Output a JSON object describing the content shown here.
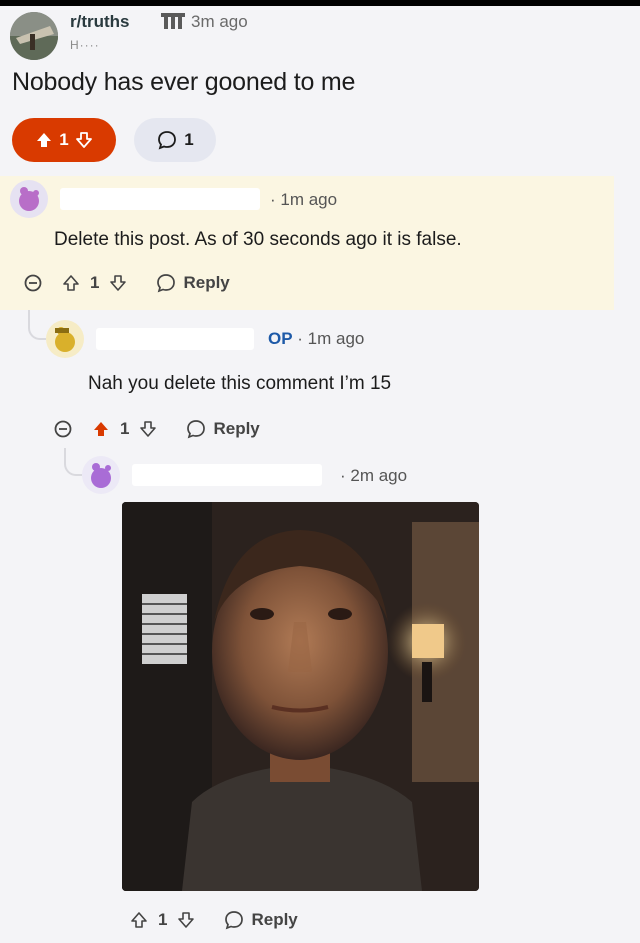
{
  "post": {
    "subreddit": "r/truths",
    "time": "3m ago",
    "flair": "H····",
    "title": "Nobody has ever gooned to me",
    "votes": "1",
    "comments": "1"
  },
  "comments": [
    {
      "meta": "· 1m ago",
      "text": "Delete this post. As of 30 seconds ago it is false.",
      "votes": "1",
      "reply_label": "Reply"
    },
    {
      "op_label": "OP",
      "meta": "· 1m ago",
      "text": "Nah you delete this comment I’m 15",
      "votes": "1",
      "reply_label": "Reply"
    },
    {
      "meta": "· 2m ago",
      "votes": "1",
      "reply_label": "Reply"
    }
  ],
  "colors": {
    "upvote_active": "#d93a00",
    "op_blue": "#1e5aa8",
    "highlight": "#fbf6e2"
  },
  "icons": [
    "subreddit-avatar",
    "award-icon",
    "upvote-icon",
    "downvote-icon",
    "comment-icon",
    "collapse-icon",
    "reply-icon",
    "snoo-avatar"
  ]
}
